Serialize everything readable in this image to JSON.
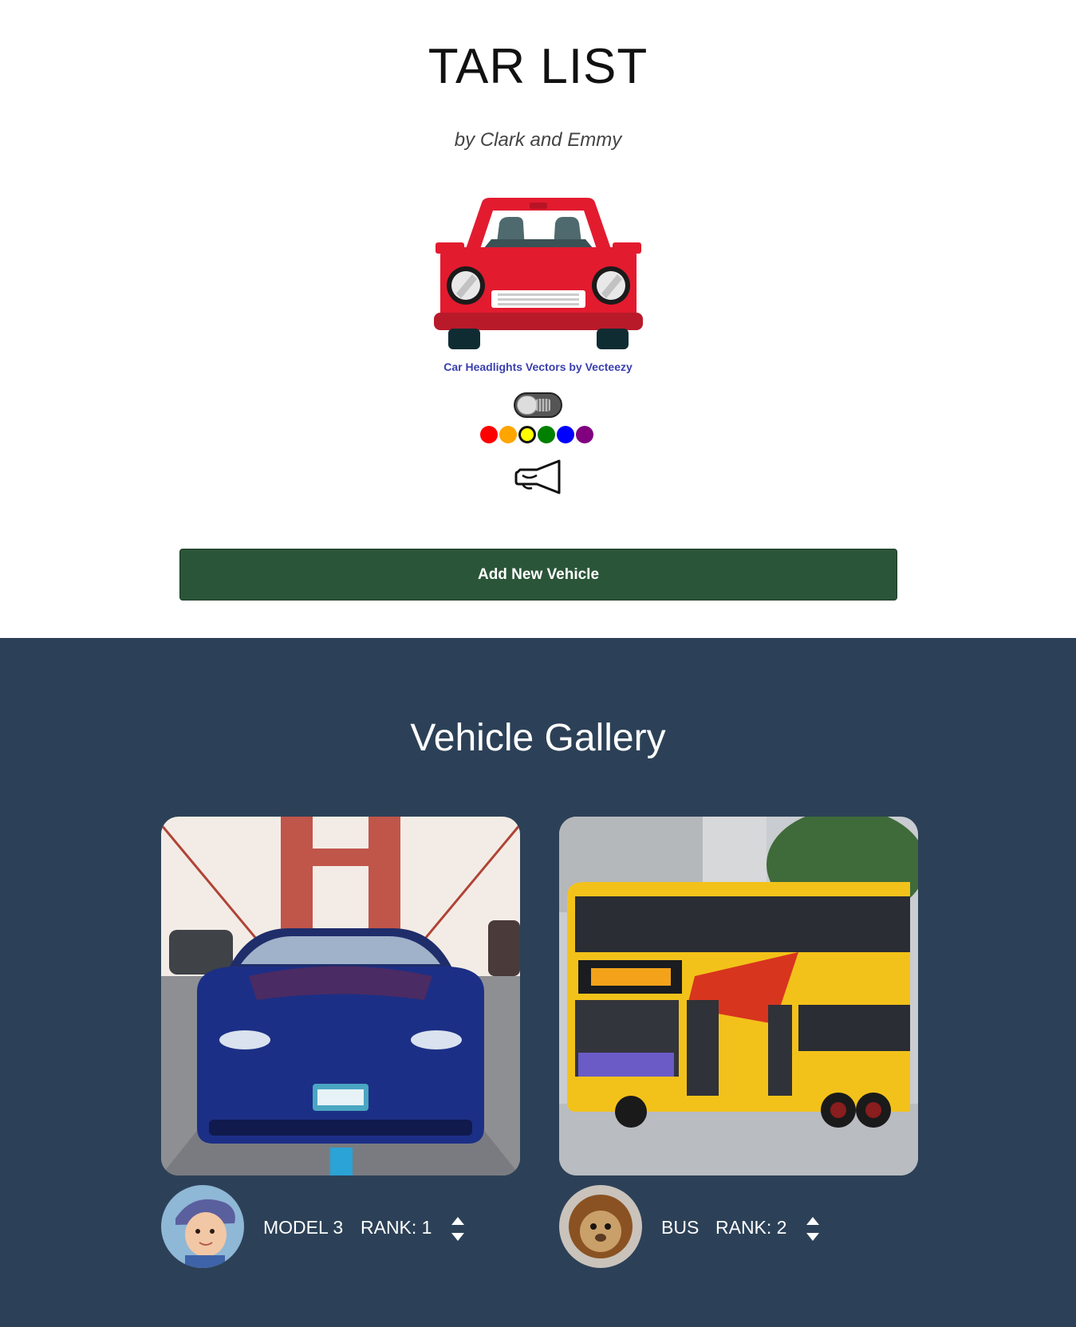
{
  "header": {
    "title": "TAR LIST",
    "subtitle": "by Clark and Emmy",
    "credit_link": "Car Headlights Vectors by Vecteezy"
  },
  "controls": {
    "toggle_state": "off",
    "colors": [
      {
        "name": "red",
        "hex": "#ff0000",
        "selected": false
      },
      {
        "name": "orange",
        "hex": "#ffa500",
        "selected": false
      },
      {
        "name": "yellow",
        "hex": "#ffff00",
        "selected": true
      },
      {
        "name": "green",
        "hex": "#008000",
        "selected": false
      },
      {
        "name": "blue",
        "hex": "#0000ff",
        "selected": false
      },
      {
        "name": "purple",
        "hex": "#800080",
        "selected": false
      }
    ],
    "horn_icon": "horn-icon",
    "car_art_color": "#e31b2f"
  },
  "add_button_label": "Add New Vehicle",
  "gallery": {
    "title": "Vehicle Gallery",
    "background": "#2c4157",
    "vehicles": [
      {
        "name": "MODEL 3",
        "rank_label": "RANK: 1",
        "photo": "blue sedan on bridge",
        "avatar": "child avatar"
      },
      {
        "name": "BUS",
        "rank_label": "RANK: 2",
        "photo": "yellow double-decker bus",
        "avatar": "lion plush avatar"
      }
    ]
  },
  "accent_colors": {
    "button": "#2b5538",
    "credit_link": "#3a3fae"
  }
}
